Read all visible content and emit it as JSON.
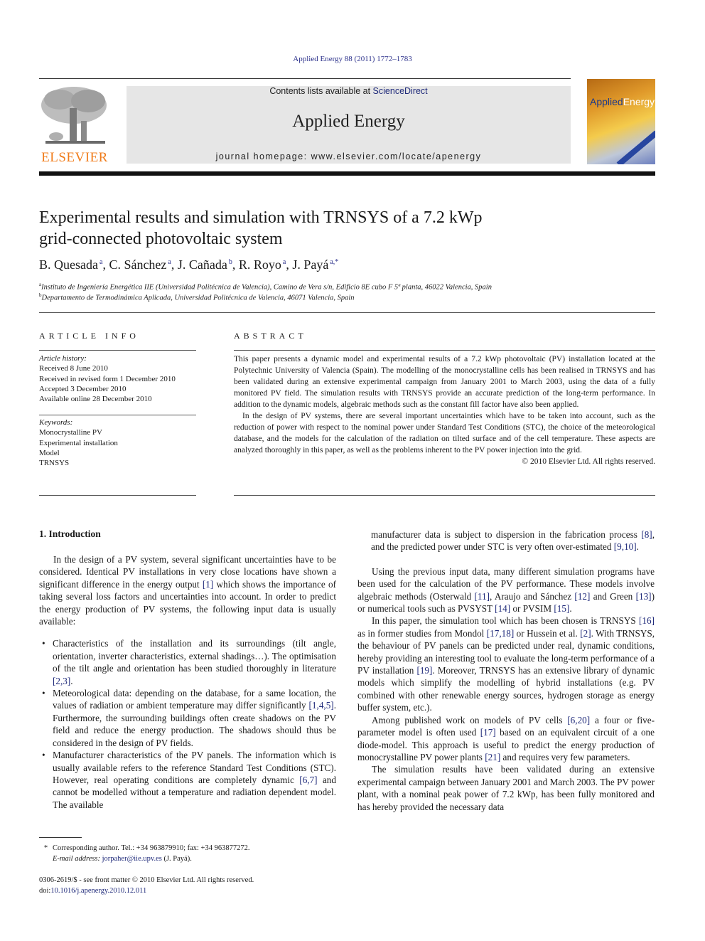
{
  "header": {
    "journal_ref": "Applied Energy 88 (2011) 1772–1783",
    "contents_prefix": "Contents lists available at ",
    "contents_link": "ScienceDirect",
    "journal_title": "Applied Energy",
    "homepage": "journal homepage: www.elsevier.com/locate/apenergy",
    "publisher_logo": "ELSEVIER",
    "cover_title_a": "Applied",
    "cover_title_b": "Energy",
    "publisher_color": "#f07c1b",
    "link_color": "#1f2a7a"
  },
  "article": {
    "title_line1": "Experimental results and simulation with TRNSYS of a 7.2 kWp",
    "title_line2": "grid-connected photovoltaic system",
    "authors": [
      {
        "name": "B. Quesada",
        "aff": "a"
      },
      {
        "name": "C. Sánchez",
        "aff": "a"
      },
      {
        "name": "J. Cañada",
        "aff": "b"
      },
      {
        "name": "R. Royo",
        "aff": "a"
      },
      {
        "name": "J. Payá",
        "aff": "a,*"
      }
    ],
    "affiliations": [
      {
        "mark": "a",
        "text": "Instituto de Ingeniería Energética IIE (Universidad Politécnica de Valencia), Camino de Vera s/n, Edificio 8E cubo F 5ª planta, 46022 Valencia, Spain"
      },
      {
        "mark": "b",
        "text": "Departamento de Termodinámica Aplicada, Universidad Politécnica de Valencia, 46071 Valencia, Spain"
      }
    ]
  },
  "article_info": {
    "heading": "ARTICLE INFO",
    "history_label": "Article history:",
    "history": [
      "Received 8 June 2010",
      "Received in revised form 1 December 2010",
      "Accepted 3 December 2010",
      "Available online 28 December 2010"
    ],
    "keywords_label": "Keywords:",
    "keywords": [
      "Monocrystalline PV",
      "Experimental installation",
      "Model",
      "TRNSYS"
    ]
  },
  "abstract": {
    "heading": "ABSTRACT",
    "p1": "This paper presents a dynamic model and experimental results of a 7.2 kWp photovoltaic (PV) installation located at the Polytechnic University of Valencia (Spain). The modelling of the monocrystalline cells has been realised in TRNSYS and has been validated during an extensive experimental campaign from January 2001 to March 2003, using the data of a fully monitored PV field. The simulation results with TRNSYS provide an accurate prediction of the long-term performance. In addition to the dynamic models, algebraic methods such as the constant fill factor have also been applied.",
    "p2": "In the design of PV systems, there are several important uncertainties which have to be taken into account, such as the reduction of power with respect to the nominal power under Standard Test Conditions (STC), the choice of the meteorological database, and the models for the calculation of the radiation on tilted surface and of the cell temperature. These aspects are analyzed thoroughly in this paper, as well as the problems inherent to the PV power injection into the grid.",
    "copyright": "© 2010 Elsevier Ltd. All rights reserved."
  },
  "body": {
    "intro_heading": "1. Introduction",
    "intro_p1": [
      {
        "t": "In the design of a PV system, several significant uncertainties have to be considered. Identical PV installations in very close locations have shown a significant difference in the energy output "
      },
      {
        "ref": "[1]"
      },
      {
        "t": " which shows the importance of taking several loss factors and uncertainties into account. In order to predict the energy production of PV systems, the following input data is usually available:"
      }
    ],
    "bullets": [
      [
        {
          "t": "Characteristics of the installation and its surroundings (tilt angle, orientation, inverter characteristics, external shadings…). The optimisation of the tilt angle and orientation has been studied thoroughly in literature "
        },
        {
          "ref": "[2,3]"
        },
        {
          "t": "."
        }
      ],
      [
        {
          "t": "Meteorological data: depending on the database, for a same location, the values of radiation or ambient temperature may differ significantly "
        },
        {
          "ref": "[1,4,5]"
        },
        {
          "t": ". Furthermore, the surrounding buildings often create shadows on the PV field and reduce the energy production. The shadows should thus be considered in the design of PV fields."
        }
      ],
      [
        {
          "t": "Manufacturer characteristics of the PV panels. The information which is usually available refers to the reference Standard Test Conditions (STC). However, real operating conditions are completely dynamic "
        },
        {
          "ref": "[6,7]"
        },
        {
          "t": " and cannot be modelled without a temperature and radiation dependent model. The available"
        }
      ]
    ],
    "right_cont": [
      {
        "t": "manufacturer data is subject to dispersion in the fabrication process "
      },
      {
        "ref": "[8]"
      },
      {
        "t": ", and the predicted power under STC is very often over-estimated "
      },
      {
        "ref": "[9,10]"
      },
      {
        "t": "."
      }
    ],
    "right_p1": [
      {
        "t": "Using the previous input data, many different simulation programs have been used for the calculation of the PV performance. These models involve algebraic methods (Osterwald "
      },
      {
        "ref": "[11]"
      },
      {
        "t": ", Araujo and Sánchez "
      },
      {
        "ref": "[12]"
      },
      {
        "t": " and Green "
      },
      {
        "ref": "[13]"
      },
      {
        "t": ") or numerical tools such as PVSYST "
      },
      {
        "ref": "[14]"
      },
      {
        "t": " or PVSIM "
      },
      {
        "ref": "[15]"
      },
      {
        "t": "."
      }
    ],
    "right_p2": [
      {
        "t": "In this paper, the simulation tool which has been chosen is TRNSYS "
      },
      {
        "ref": "[16]"
      },
      {
        "t": " as in former studies from Mondol "
      },
      {
        "ref": "[17,18]"
      },
      {
        "t": " or Hussein et al. "
      },
      {
        "ref": "[2]"
      },
      {
        "t": ". With TRNSYS, the behaviour of PV panels can be predicted under real, dynamic conditions, hereby providing an interesting tool to evaluate the long-term performance of a PV installation "
      },
      {
        "ref": "[19]"
      },
      {
        "t": ". Moreover, TRNSYS has an extensive library of dynamic models which simplify the modelling of hybrid installations (e.g. PV combined with other renewable energy sources, hydrogen storage as energy buffer system, etc.)."
      }
    ],
    "right_p3": [
      {
        "t": "Among published work on models of PV cells "
      },
      {
        "ref": "[6,20]"
      },
      {
        "t": " a four or five-parameter model is often used "
      },
      {
        "ref": "[17]"
      },
      {
        "t": " based on an equivalent circuit of a one diode-model. This approach is useful to predict the energy production of monocrystalline PV power plants "
      },
      {
        "ref": "[21]"
      },
      {
        "t": " and requires very few parameters."
      }
    ],
    "right_p4": [
      {
        "t": "The simulation results have been validated during an extensive experimental campaign between January 2001 and March 2003. The PV power plant, with a nominal peak power of 7.2 kWp, has been fully monitored and has hereby provided the necessary data"
      }
    ]
  },
  "footnote": {
    "mark": "*",
    "corresponding": "Corresponding author. Tel.: +34 963879910; fax: +34 963877272.",
    "email_label": "E-mail address: ",
    "email": "jorpaher@iie.upv.es",
    "email_suffix": " (J. Payá)."
  },
  "issn": {
    "line": "0306-2619/$ - see front matter © 2010 Elsevier Ltd. All rights reserved.",
    "doi_label": "doi:",
    "doi": "10.1016/j.apenergy.2010.12.011"
  }
}
